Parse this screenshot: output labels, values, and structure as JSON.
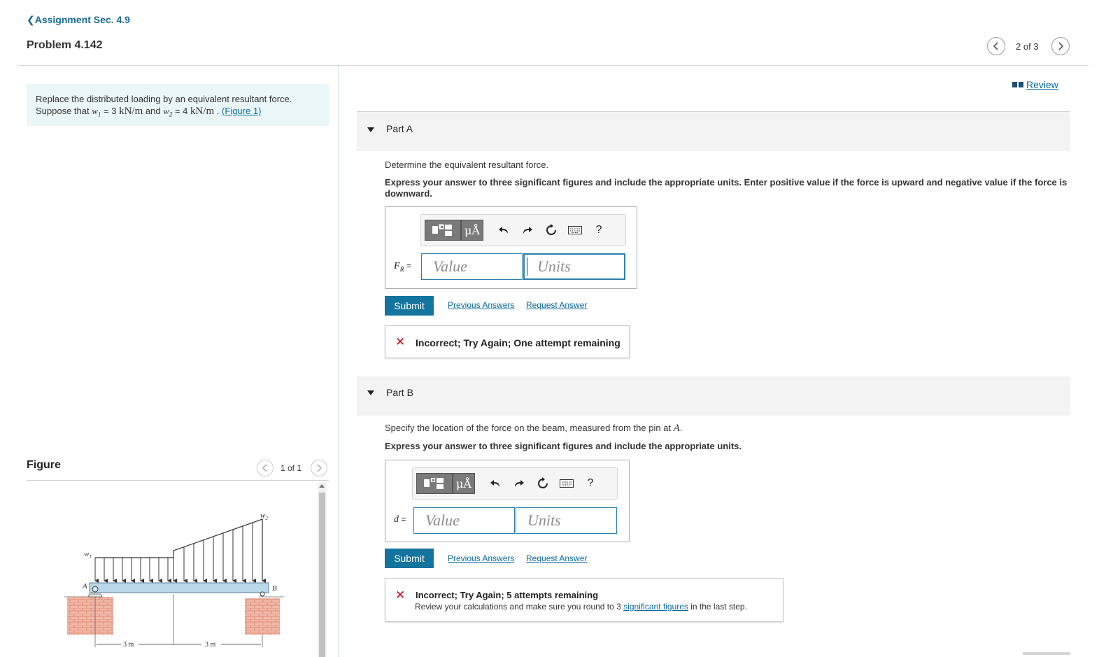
{
  "header": {
    "back_link": "Assignment Sec. 4.9",
    "problem_title": "Problem 4.142",
    "pager_text": "2 of 3"
  },
  "intro": {
    "line1": "Replace the distributed loading by an equivalent resultant force.",
    "suppose": "Suppose that",
    "w1_sym": "w",
    "w1_sub": "1",
    "w1_val": " = 3 ",
    "unit1": "kN/m",
    "and": " and ",
    "w2_sym": "w",
    "w2_sub": "2",
    "w2_val": " = 4 ",
    "unit2": "kN/m",
    "dot": " . ",
    "figure_link": "(Figure 1)"
  },
  "figure": {
    "label": "Figure",
    "pager_text": "1 of 1",
    "labels": {
      "w1": "w",
      "w1_sub": "1",
      "w2": "w",
      "w2_sub": "2",
      "A": "A",
      "B": "B",
      "dim1": "3 m",
      "dim2": "3 m"
    }
  },
  "review_link": "Review",
  "partA": {
    "label": "Part A",
    "question": "Determine the equivalent resultant force.",
    "instruction": "Express your answer to three significant figures and include the appropriate units. Enter positive value if the force is upward and negative value if the force is downward.",
    "var_main": "F",
    "var_sub": "R",
    "equals": " =",
    "value_placeholder": "Value",
    "units_placeholder": "Units",
    "submit": "Submit",
    "previous_answers": "Previous Answers",
    "request_answer": "Request Answer",
    "feedback": "Incorrect; Try Again; One attempt remaining"
  },
  "partB": {
    "label": "Part B",
    "question_prefix": "Specify the location of the force on the beam, measured from the pin at ",
    "question_var": "A",
    "question_suffix": ".",
    "instruction": "Express your answer to three significant figures and include the appropriate units.",
    "var_main": "d",
    "equals": " =",
    "value_placeholder": "Value",
    "units_placeholder": "Units",
    "submit": "Submit",
    "previous_answers": "Previous Answers",
    "request_answer": "Request Answer",
    "feedback_title": "Incorrect; Try Again; 5 attempts remaining",
    "feedback_prefix": "Review your calculations and make sure you round to 3 ",
    "feedback_link": "significant figures",
    "feedback_suffix": " in the last step."
  },
  "toolbar": {
    "mu_label": "μÅ",
    "help": "?"
  },
  "colors": {
    "accent": "#13749e",
    "link": "#0b6aa2",
    "error": "#d0021b",
    "intro_bg": "#eaf6f7"
  },
  "icons": [
    "chevron-left-icon",
    "chevron-right-icon",
    "book-icon",
    "templates-icon",
    "undo-icon",
    "redo-icon",
    "reset-icon",
    "keyboard-icon",
    "help-icon",
    "x-mark-icon",
    "caret-down-icon"
  ]
}
